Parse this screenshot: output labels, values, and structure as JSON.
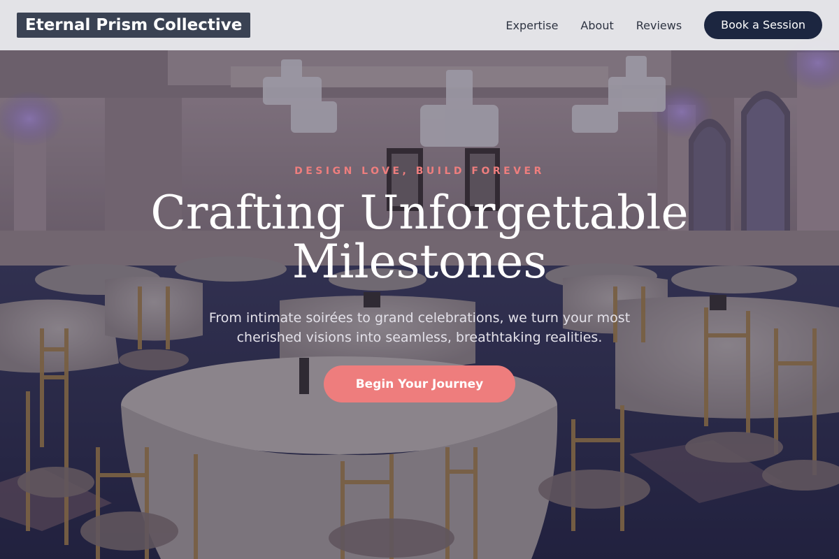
{
  "nav": {
    "brand": "Eternal Prism Collective",
    "links": [
      "Expertise",
      "About",
      "Reviews"
    ],
    "cta": "Book a Session"
  },
  "hero": {
    "eyebrow": "DESIGN LOVE, BUILD FOREVER",
    "title_line1": "Crafting Unforgettable",
    "title_line2": "Milestones",
    "subtitle_line1": "From intimate soirées to grand celebrations, we turn your most",
    "subtitle_line2": "cherished visions into seamless, breathtaking realities.",
    "cta": "Begin Your Journey"
  },
  "colors": {
    "accent": "#ee7d7d",
    "navy": "#1c2640",
    "brand_bg": "#3a4253"
  }
}
